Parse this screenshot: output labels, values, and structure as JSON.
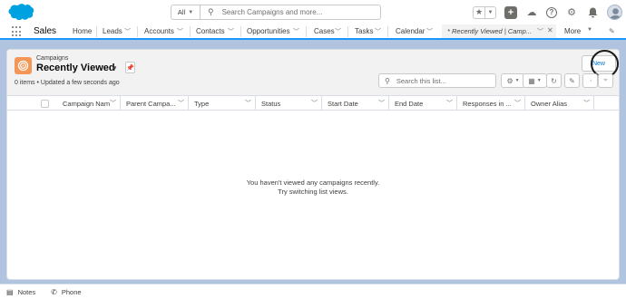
{
  "global_header": {
    "search_scope": "All",
    "search_placeholder": "Search Campaigns and more..."
  },
  "nav": {
    "app_name": "Sales",
    "items": [
      "Home",
      "Leads",
      "Accounts",
      "Contacts",
      "Opportunities",
      "Cases",
      "Tasks",
      "Calendar"
    ],
    "active_tab": "* Recently Viewed | Camp...",
    "more": "More"
  },
  "list_view": {
    "breadcrumb": "Campaigns",
    "title": "Recently Viewed",
    "status": "0 items • Updated a few seconds ago",
    "new_button": "New",
    "search_placeholder": "Search this list...",
    "columns": [
      "Campaign Name",
      "Parent Campa...",
      "Type",
      "Status",
      "Start Date",
      "End Date",
      "Responses in ...",
      "Owner Alias"
    ],
    "empty_line1": "You haven't viewed any campaigns recently.",
    "empty_line2": "Try switching list views."
  },
  "utility_bar": {
    "notes": "Notes",
    "phone": "Phone"
  },
  "colors": {
    "brand_blue": "#1b96ff",
    "campaign_icon": "#f49756",
    "background": "#b0c4df"
  }
}
